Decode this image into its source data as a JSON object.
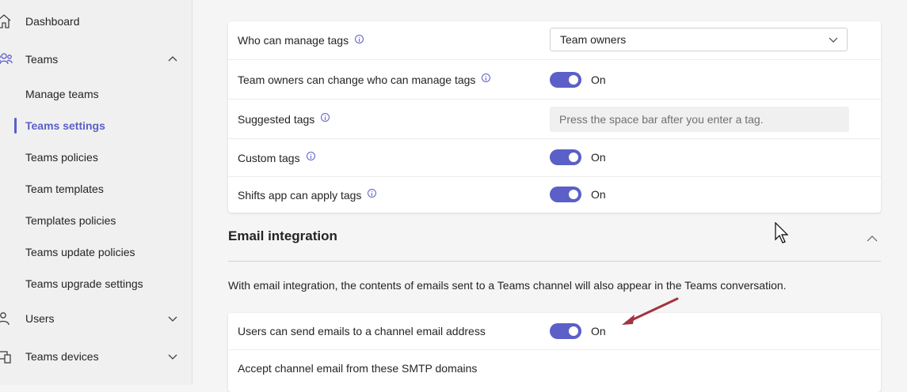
{
  "sidebar": {
    "dashboard_label": "Dashboard",
    "teams_label": "Teams",
    "teams_items": [
      "Manage teams",
      "Teams settings",
      "Teams policies",
      "Team templates",
      "Templates policies",
      "Teams update policies",
      "Teams upgrade settings"
    ],
    "active_item": "Teams settings",
    "users_label": "Users",
    "devices_label": "Teams devices"
  },
  "tagging": {
    "rows": [
      {
        "label": "Who can manage tags",
        "control": "select",
        "value": "Team owners"
      },
      {
        "label": "Team owners can change who can manage tags",
        "control": "toggle",
        "state": "On"
      },
      {
        "label": "Suggested tags",
        "control": "input",
        "placeholder": "Press the space bar after you enter a tag."
      },
      {
        "label": "Custom tags",
        "control": "toggle",
        "state": "On"
      },
      {
        "label": "Shifts app can apply tags",
        "control": "toggle",
        "state": "On"
      }
    ]
  },
  "email_integration": {
    "title": "Email integration",
    "description": "With email integration, the contents of emails sent to a Teams channel will also appear in the Teams conversation.",
    "rows": [
      {
        "label": "Users can send emails to a channel email address",
        "control": "toggle",
        "state": "On"
      },
      {
        "label": "Accept channel email from these SMTP domains"
      }
    ]
  },
  "colors": {
    "accent": "#5b5fc7",
    "annotation_arrow": "#a23340",
    "sidebar_bg": "#f0f0f0",
    "page_bg": "#f5f5f5"
  },
  "icons": [
    "home-icon",
    "teams-icon",
    "chevron-up-icon",
    "users-icon",
    "devices-icon",
    "chevron-down-icon",
    "info-icon"
  ]
}
